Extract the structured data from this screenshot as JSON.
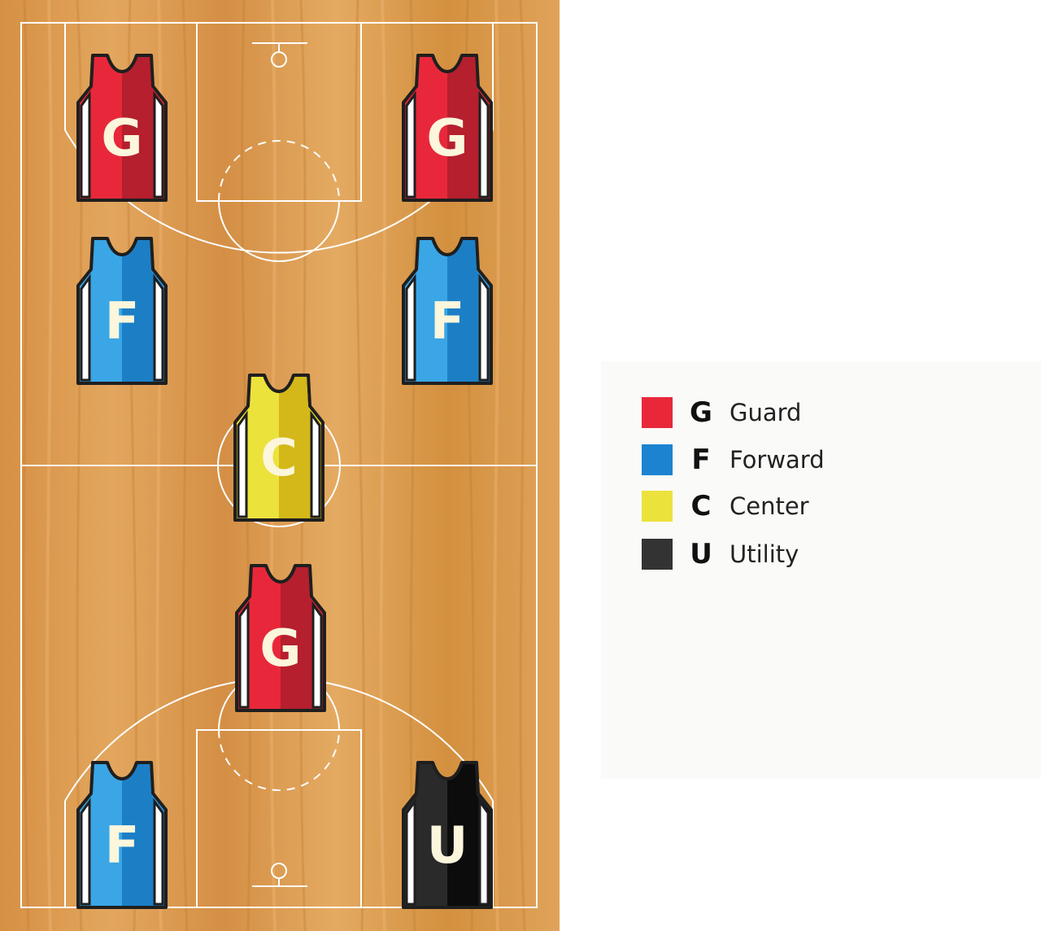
{
  "court": {
    "colors": {
      "wood": "#d99a50",
      "line": "#ffffff"
    }
  },
  "players": [
    {
      "code": "G",
      "team_color": "#e8283a",
      "shade_color": "#b51f2e"
    },
    {
      "code": "G",
      "team_color": "#e8283a",
      "shade_color": "#b51f2e"
    },
    {
      "code": "F",
      "team_color": "#3aa6e6",
      "shade_color": "#1c7fc6"
    },
    {
      "code": "F",
      "team_color": "#3aa6e6",
      "shade_color": "#1c7fc6"
    },
    {
      "code": "C",
      "team_color": "#ece23c",
      "shade_color": "#d4b81a"
    },
    {
      "code": "G",
      "team_color": "#e8283a",
      "shade_color": "#b51f2e"
    },
    {
      "code": "F",
      "team_color": "#3aa6e6",
      "shade_color": "#1c7fc6"
    },
    {
      "code": "U",
      "team_color": "#2a2a2a",
      "shade_color": "#0c0c0c"
    }
  ],
  "legend": {
    "items": [
      {
        "code": "G",
        "label": "Guard",
        "color": "#e8283a"
      },
      {
        "code": "F",
        "label": "Forward",
        "color": "#1c83d0"
      },
      {
        "code": "C",
        "label": "Center",
        "color": "#ece23c"
      },
      {
        "code": "U",
        "label": "Utility",
        "color": "#333333"
      }
    ]
  }
}
